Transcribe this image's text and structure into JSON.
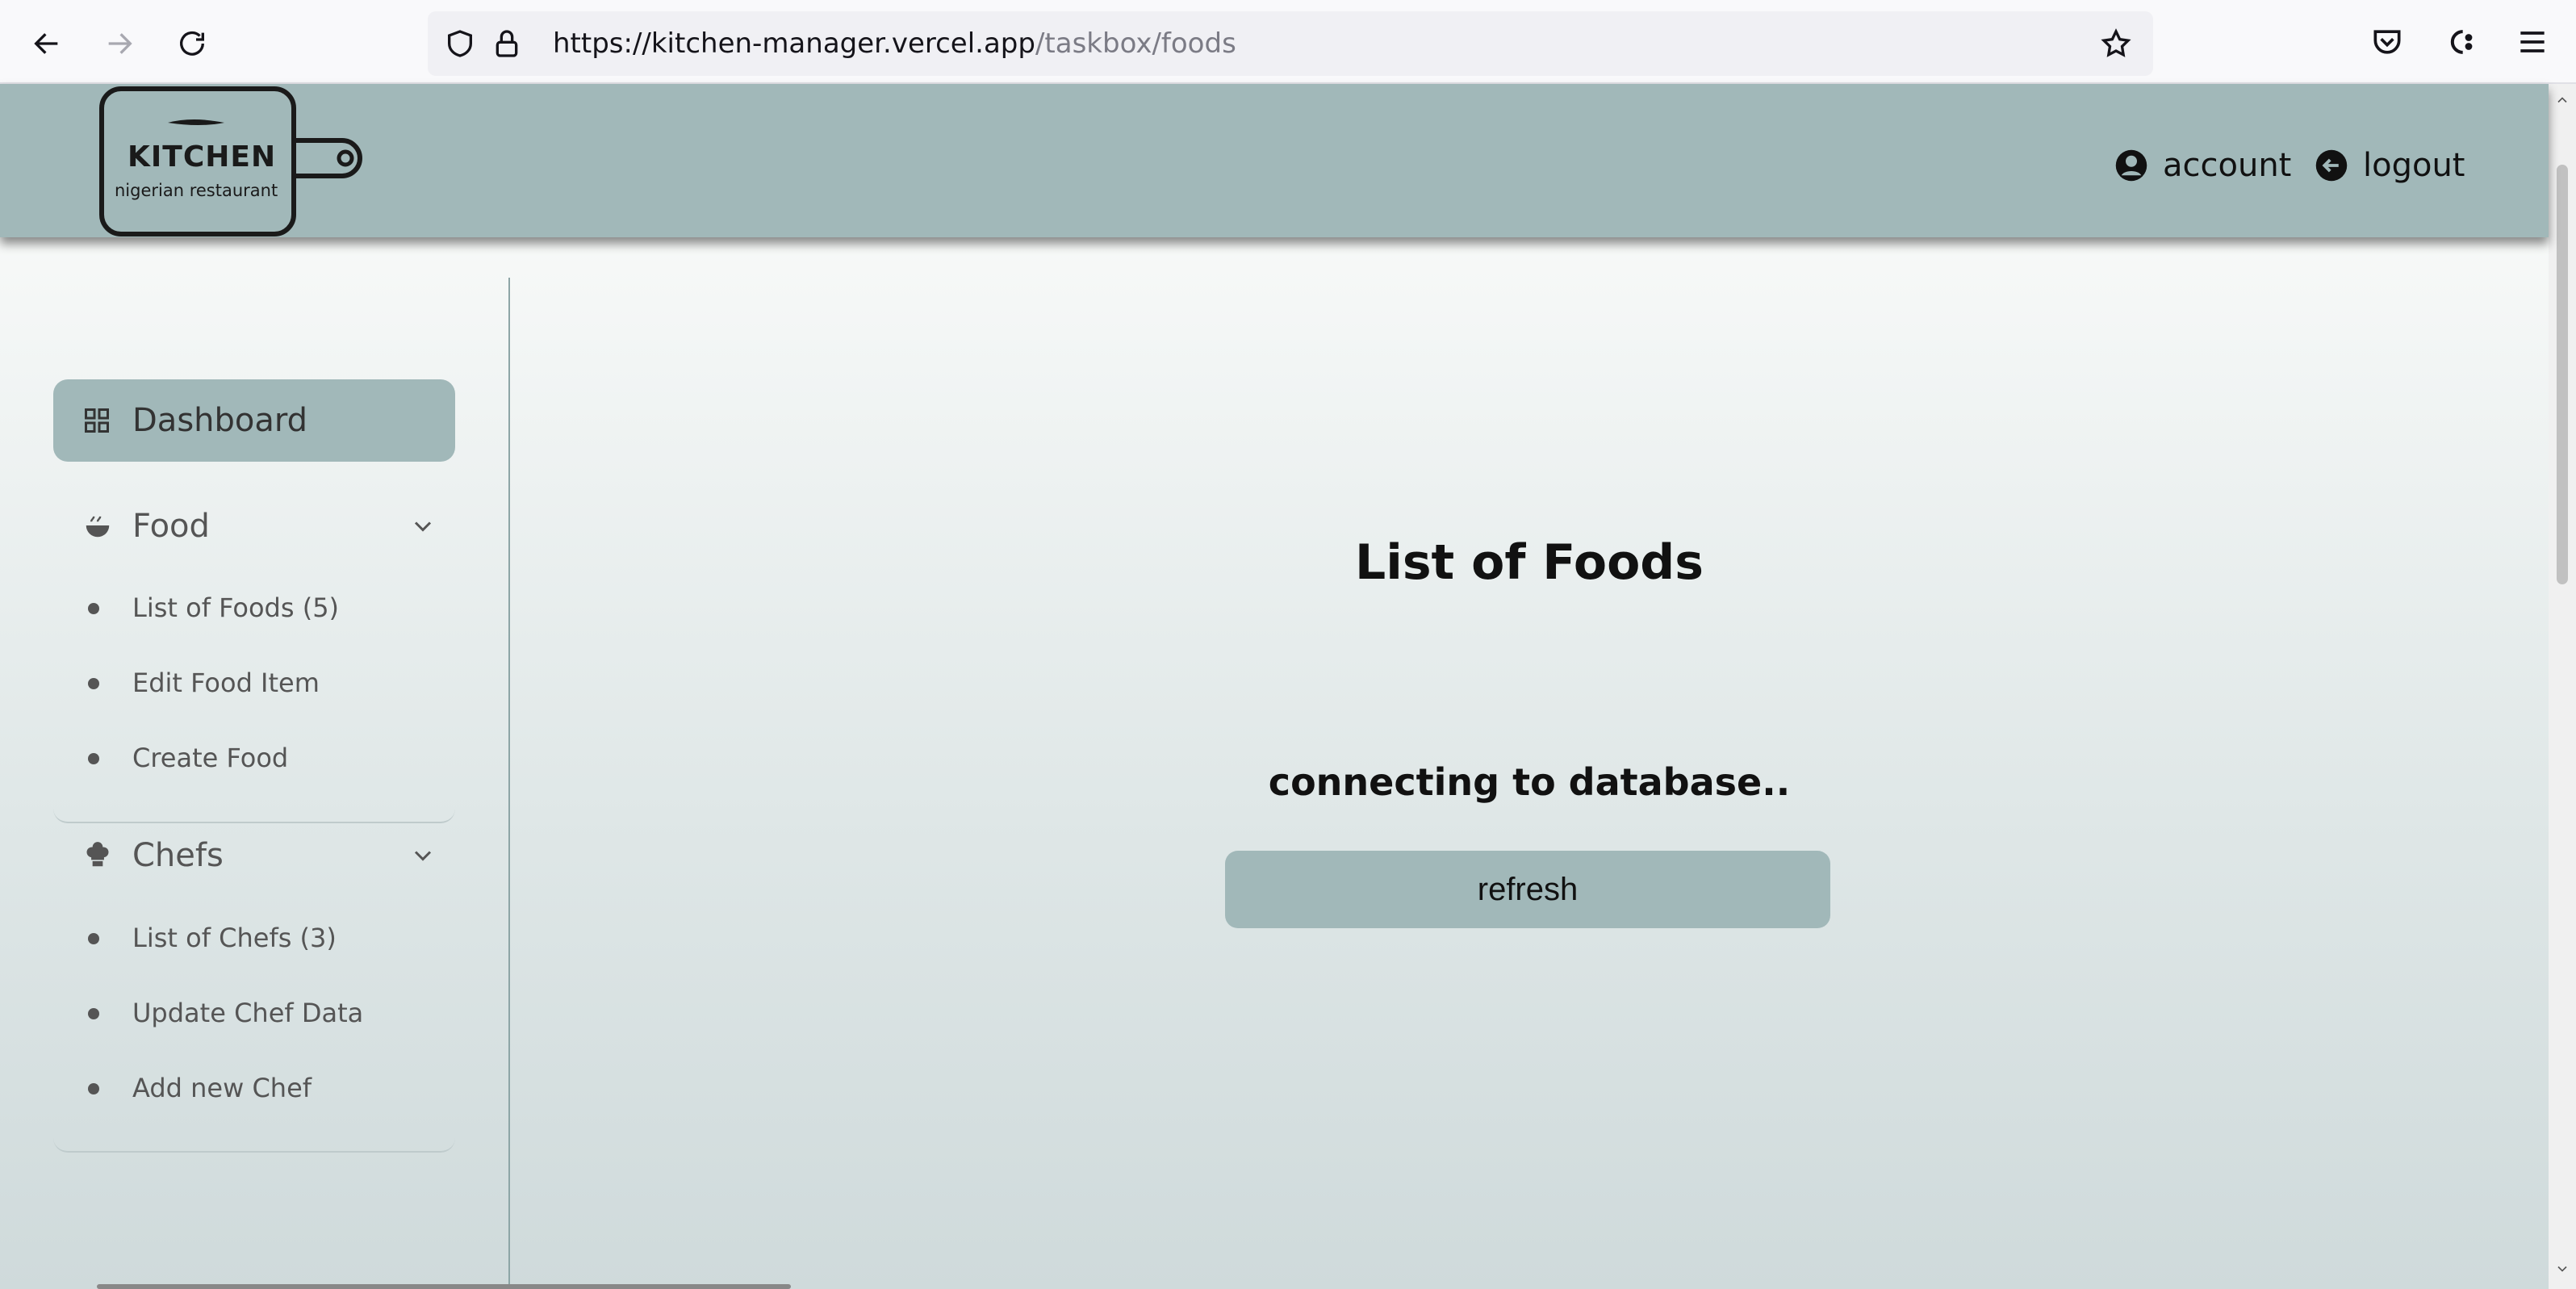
{
  "browser": {
    "url_host": "https://kitchen-manager.vercel.app",
    "url_path": "/taskbox/foods"
  },
  "header": {
    "logo_title": "KITCHEN",
    "logo_subtitle": "nigerian restaurant",
    "account_label": "account",
    "logout_label": "logout"
  },
  "sidebar": {
    "dashboard_label": "Dashboard",
    "groups": [
      {
        "label": "Food",
        "icon": "food-bowl-icon",
        "items": [
          {
            "label": "List of Foods (5)"
          },
          {
            "label": "Edit Food Item"
          },
          {
            "label": "Create Food"
          }
        ]
      },
      {
        "label": "Chefs",
        "icon": "chef-hat-icon",
        "items": [
          {
            "label": "List of Chefs (3)"
          },
          {
            "label": "Update Chef Data"
          },
          {
            "label": "Add new Chef"
          }
        ]
      }
    ]
  },
  "main": {
    "title": "List of Foods",
    "status": "connecting to database..",
    "refresh_label": "refresh"
  },
  "colors": {
    "accent": "#a1b8b9",
    "text": "#111111"
  }
}
